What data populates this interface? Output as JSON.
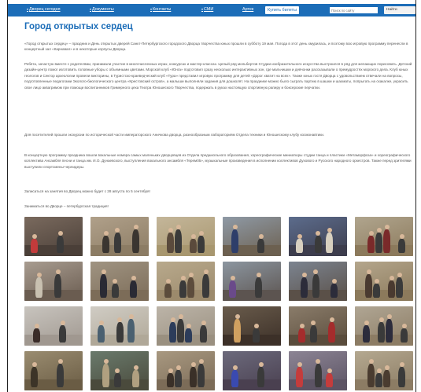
{
  "nav": {
    "items": [
      {
        "label": "Дворец сегодня",
        "arrow": "▾"
      },
      {
        "label": "Документы",
        "arrow": "▾"
      },
      {
        "label": "Контакты",
        "arrow": "▾"
      },
      {
        "label": "СМИ",
        "arrow": "▾"
      },
      {
        "label": "Артек",
        "arrow": ""
      }
    ],
    "buy_tickets": "Купить билеты",
    "search_placeholder": "Поиск по сайту",
    "search_button": "Найти",
    "accent": "#1c6db8"
  },
  "page": {
    "title": "Город открытых сердец",
    "paragraphs": [
      "«Город открытых сердец» – праздник и День открытых дверей Санкт-Петербургского городского Дворца творчества юных прошли в субботу 19 мая. Погода в этот день хмурилась, и поэтому всю игровую программу перенесли в концертный зал «Карнавал» и в некоторые корпусы Дворца.",
      "Ребята, зачастую вместе с родителями, принимали участие в многочисленных играх, конкурсах и мастер-классах. Целый ряд мольбертов Студии изобразительного искусства выстроился в ряд для желающих порисовать. Детский дизайн-центр помог изготовить головные уборы с объемными цветами. Морской клуб «Юнга» подготовил сразу несколько интерактивных зон, где мальчишки и девчонки рассказывали о премудростях морского дела. Клуб юных геологов и Сектор археологии провели викторины, в Туристско-краеведческий клуб «Тура» представил игровую программу для детей «Дорог хватит на всех». Также юных гостя Дворца с удовольствием отвечали на вопросы, подготовленные педагогами Эколого-биологического центра «Крестовский остров», а малыши выполняли задания для дошколят. На празднике можно было сыграть партию в шашки и шахматы, попрыгать на скакалке, украсить свое лицо аквагримом при помощи воспитанников Гримерного цеха Театра Юношеского Творчества, подержать в руках настоящую спортивную рапиру и боксерские перчатки.",
      "Для посетителей прошли экскурсии по исторической части императорского Аничкова дворца, разнообразным лабораториям Отдела техники и Юношескому клубу космонавтики.",
      "В концертную программу праздника вошли вокальные номера самых маленьких дворцовцев из Отдела предшкольного образования, хореографические миниатюры студии танца и пластики «Метаморфоза» и хореографического коллектива Ансамбля песни и танца им. И.О. Дунаевского, выступления вокального ансамбля «Терем05», музыкальные произведения в исполнении коллективов Духового и Русского народного оркестров. Также перед зрителями выступили спортсмены-черлидеры.",
      "Записаться на занятия во Дворец можно будет с 28 августа по 5 сентября!",
      "Заниматься во Дворце – петербургская традиция!"
    ]
  },
  "gallery": {
    "photos": [
      {
        "label": "photo-1",
        "bg": "#7a6a5e",
        "fg": "#c23b3b",
        "floor": "#4a3f38"
      },
      {
        "label": "photo-2",
        "bg": "#b0a08a",
        "fg": "#3a3530",
        "floor": "#8c7c64"
      },
      {
        "label": "photo-3",
        "bg": "#c4b69a",
        "fg": "#5a4a3c",
        "floor": "#a8976f"
      },
      {
        "label": "photo-4",
        "bg": "#8f9aa6",
        "fg": "#2e3e6a",
        "floor": "#6c6050"
      },
      {
        "label": "photo-5",
        "bg": "#5c6c8c",
        "fg": "#d8d0c0",
        "floor": "#3d3d4d"
      },
      {
        "label": "photo-6",
        "bg": "#b0a58e",
        "fg": "#7a2a2a",
        "floor": "#8c7a5c"
      },
      {
        "label": "photo-7",
        "bg": "#a89c90",
        "fg": "#c8c0b0",
        "floor": "#6a5c50"
      },
      {
        "label": "photo-8",
        "bg": "#a09482",
        "fg": "#2a2a34",
        "floor": "#7c6c58"
      },
      {
        "label": "photo-9",
        "bg": "#b8a98c",
        "fg": "#5c4c3c",
        "floor": "#9c8a6c"
      },
      {
        "label": "photo-10",
        "bg": "#8c96a0",
        "fg": "#6a4a8a",
        "floor": "#5c5450"
      },
      {
        "label": "photo-11",
        "bg": "#7c8490",
        "fg": "#2c2c3a",
        "floor": "#5a5048"
      },
      {
        "label": "photo-12",
        "bg": "#b4a68c",
        "fg": "#4a3a30",
        "floor": "#8c7a5c"
      },
      {
        "label": "photo-13",
        "bg": "#c8c4be",
        "fg": "#3a2c28",
        "floor": "#a09890"
      },
      {
        "label": "photo-14",
        "bg": "#d0ccc4",
        "fg": "#4a6070",
        "floor": "#b0a898"
      },
      {
        "label": "photo-15",
        "bg": "#bcb4a8",
        "fg": "#2c3c5a",
        "floor": "#9a9080"
      },
      {
        "label": "photo-16",
        "bg": "#6a5c4c",
        "fg": "#d0a060",
        "floor": "#3c3028"
      },
      {
        "label": "photo-17",
        "bg": "#8a7c6a",
        "fg": "#a42c2c",
        "floor": "#5a4c3c"
      },
      {
        "label": "photo-18",
        "bg": "#b0a694",
        "fg": "#2c2c3c",
        "floor": "#8c7c64"
      },
      {
        "label": "photo-19",
        "bg": "#9a8c70",
        "fg": "#3c3428",
        "floor": "#6a5c44"
      },
      {
        "label": "photo-20",
        "bg": "#6a7a6c",
        "fg": "#b0a080",
        "floor": "#4a4a3c"
      },
      {
        "label": "photo-21",
        "bg": "#a89880",
        "fg": "#3a3028",
        "floor": "#7c6c58"
      },
      {
        "label": "photo-22",
        "bg": "#6c6a7c",
        "fg": "#3a4ab0",
        "floor": "#4a4050"
      },
      {
        "label": "photo-23",
        "bg": "#8c8494",
        "fg": "#c43c3c",
        "floor": "#5c5464"
      },
      {
        "label": "photo-24",
        "bg": "#b4a890",
        "fg": "#4a3c30",
        "floor": "#8c7c64"
      }
    ]
  }
}
